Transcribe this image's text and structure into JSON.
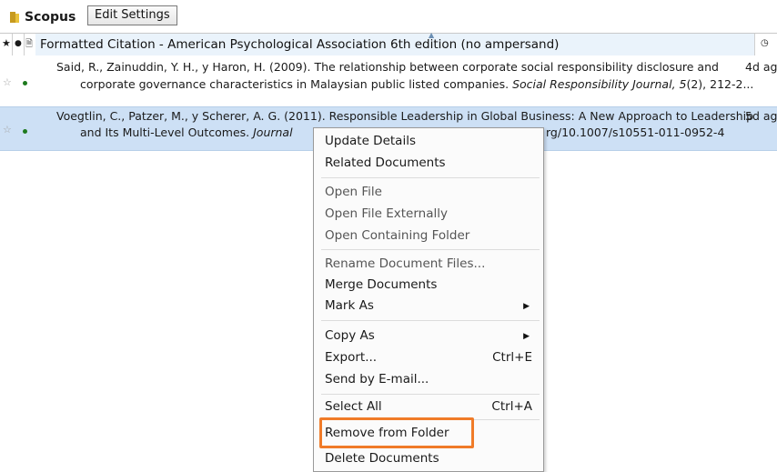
{
  "toolbar": {
    "folder_name": "Scopus",
    "edit_settings_label": "Edit Settings"
  },
  "header": {
    "citation_style": "Formatted Citation - American Psychological Association 6th edition (no ampersand)"
  },
  "rows": [
    {
      "line1": "Said, R., Zainuddin, Y. H., y Haron, H. (2009). The relationship between corporate social responsibility disclosure and",
      "line2_pre": "corporate governance characteristics in Malaysian public listed companies. ",
      "line2_journal": "Social Responsibility Journal, 5",
      "line2_post": "(2), 212-2...",
      "date": "4d ag"
    },
    {
      "line1": "Voegtlin, C., Patzer, M., y Scherer, A. G. (2011). Responsible Leadership in Global Business: A New Approach to Leadership",
      "line2_pre": "and Its Multi-Level Outcomes. ",
      "line2_journal": "Journal",
      "line2_post": "rg/10.1007/s10551-011-0952-4",
      "date": "5d ag"
    }
  ],
  "context_menu": {
    "update_details": "Update Details",
    "related_documents": "Related Documents",
    "open_file": "Open File",
    "open_file_externally": "Open File Externally",
    "open_containing_folder": "Open Containing Folder",
    "rename_document_files": "Rename Document Files...",
    "merge_documents": "Merge Documents",
    "mark_as": "Mark As",
    "copy_as": "Copy As",
    "export": "Export...",
    "export_shortcut": "Ctrl+E",
    "send_by_email": "Send by E-mail...",
    "select_all": "Select All",
    "select_all_shortcut": "Ctrl+A",
    "remove_from_folder": "Remove from Folder",
    "delete_documents": "Delete Documents"
  },
  "colors": {
    "highlight": "#f07b28",
    "selected_row": "#cde0f5",
    "read_dot": "#1e7a1e"
  }
}
